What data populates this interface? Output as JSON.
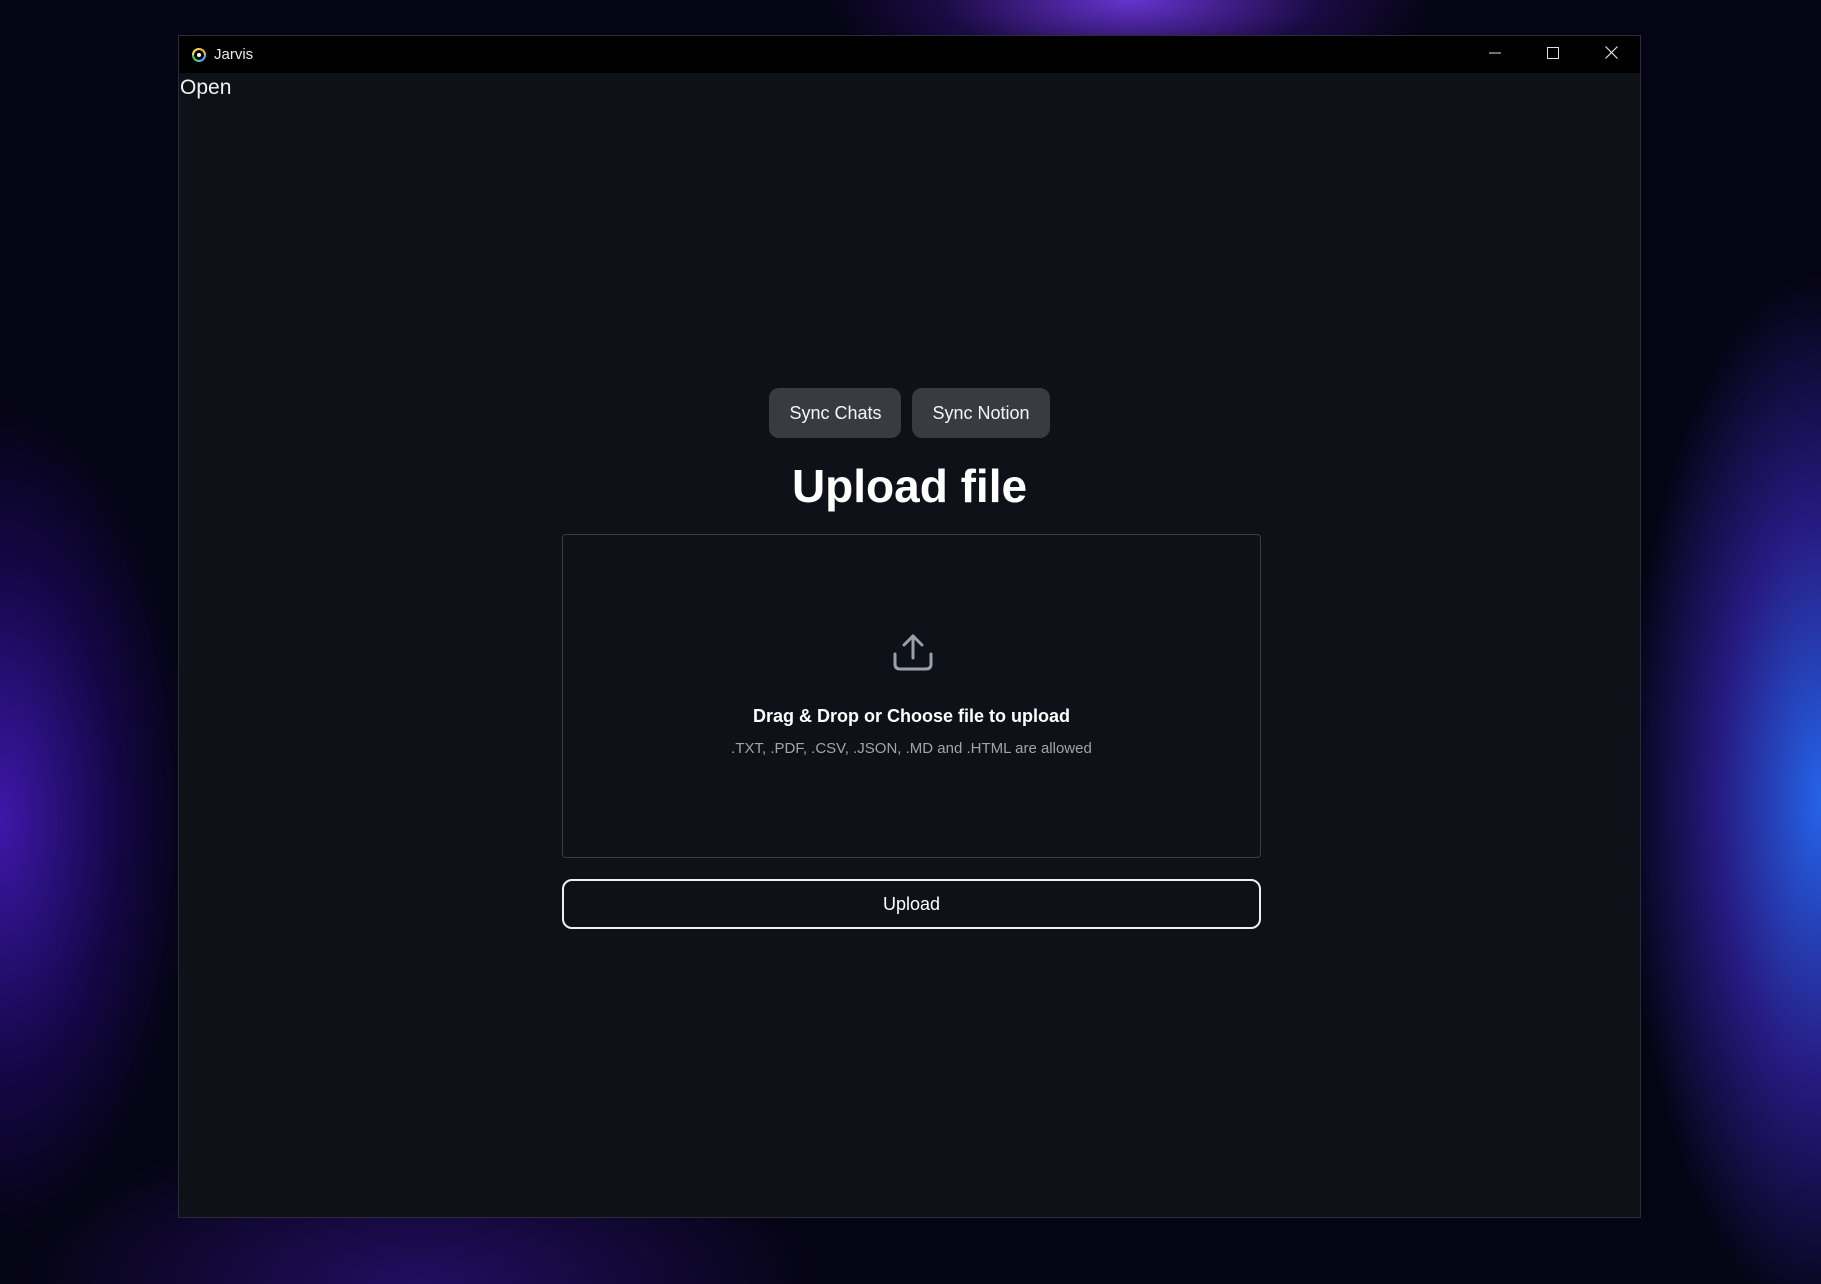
{
  "window": {
    "title": "Jarvis",
    "controls": {
      "minimize_icon": "minimize-icon",
      "maximize_icon": "maximize-icon",
      "close_icon": "close-icon"
    }
  },
  "menu": {
    "open_label": "Open"
  },
  "sync": {
    "chats_label": "Sync Chats",
    "notion_label": "Sync Notion"
  },
  "upload": {
    "title": "Upload file",
    "icon": "upload-icon",
    "drop_label": "Drag & Drop or Choose file to upload",
    "hint": ".TXT, .PDF, .CSV, .JSON, .MD and .HTML are allowed",
    "button_label": "Upload"
  },
  "colors": {
    "window_bg": "#0e1118",
    "titlebar_bg": "#000000",
    "sync_button_bg": "#3a3b41",
    "text_primary": "#ffffff",
    "text_muted": "#a0a4ad"
  }
}
